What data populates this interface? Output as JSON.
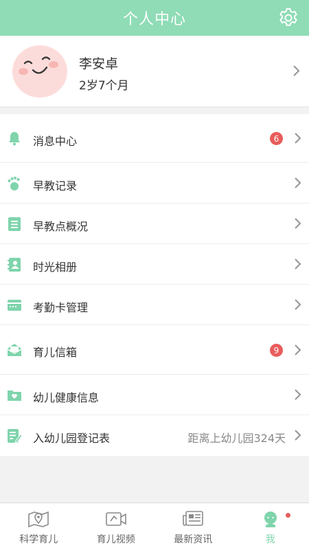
{
  "header": {
    "title": "个人中心",
    "settings_icon": "gear-icon"
  },
  "profile": {
    "name": "李安卓",
    "age": "2岁7个月",
    "avatar_icon": "smiley-face-avatar"
  },
  "menu": [
    {
      "label": "消息中心",
      "icon": "bell-icon",
      "badge": "6"
    },
    {
      "label": "早教记录",
      "icon": "footprint-icon"
    },
    {
      "label": "早教点概况",
      "icon": "document-icon"
    },
    {
      "label": "时光相册",
      "icon": "album-icon"
    },
    {
      "label": "考勤卡管理",
      "icon": "card-icon"
    },
    {
      "label": "育儿信箱",
      "icon": "mailbox-icon",
      "badge": "9"
    },
    {
      "label": "幼儿健康信息",
      "icon": "health-folder-icon"
    },
    {
      "label": "入幼儿园登记表",
      "icon": "form-edit-icon",
      "note": "距离上幼儿园324天"
    }
  ],
  "tabbar": [
    {
      "label": "科学育儿",
      "icon": "map-pin-icon",
      "active": false
    },
    {
      "label": "育儿视频",
      "icon": "video-icon",
      "active": false
    },
    {
      "label": "最新资讯",
      "icon": "news-icon",
      "active": false
    },
    {
      "label": "我",
      "icon": "user-icon",
      "active": true,
      "has_dot": true
    }
  ],
  "colors": {
    "accent": "#8fdcb6",
    "badge": "#e95c5c",
    "icon_green": "#7fd4ac"
  }
}
